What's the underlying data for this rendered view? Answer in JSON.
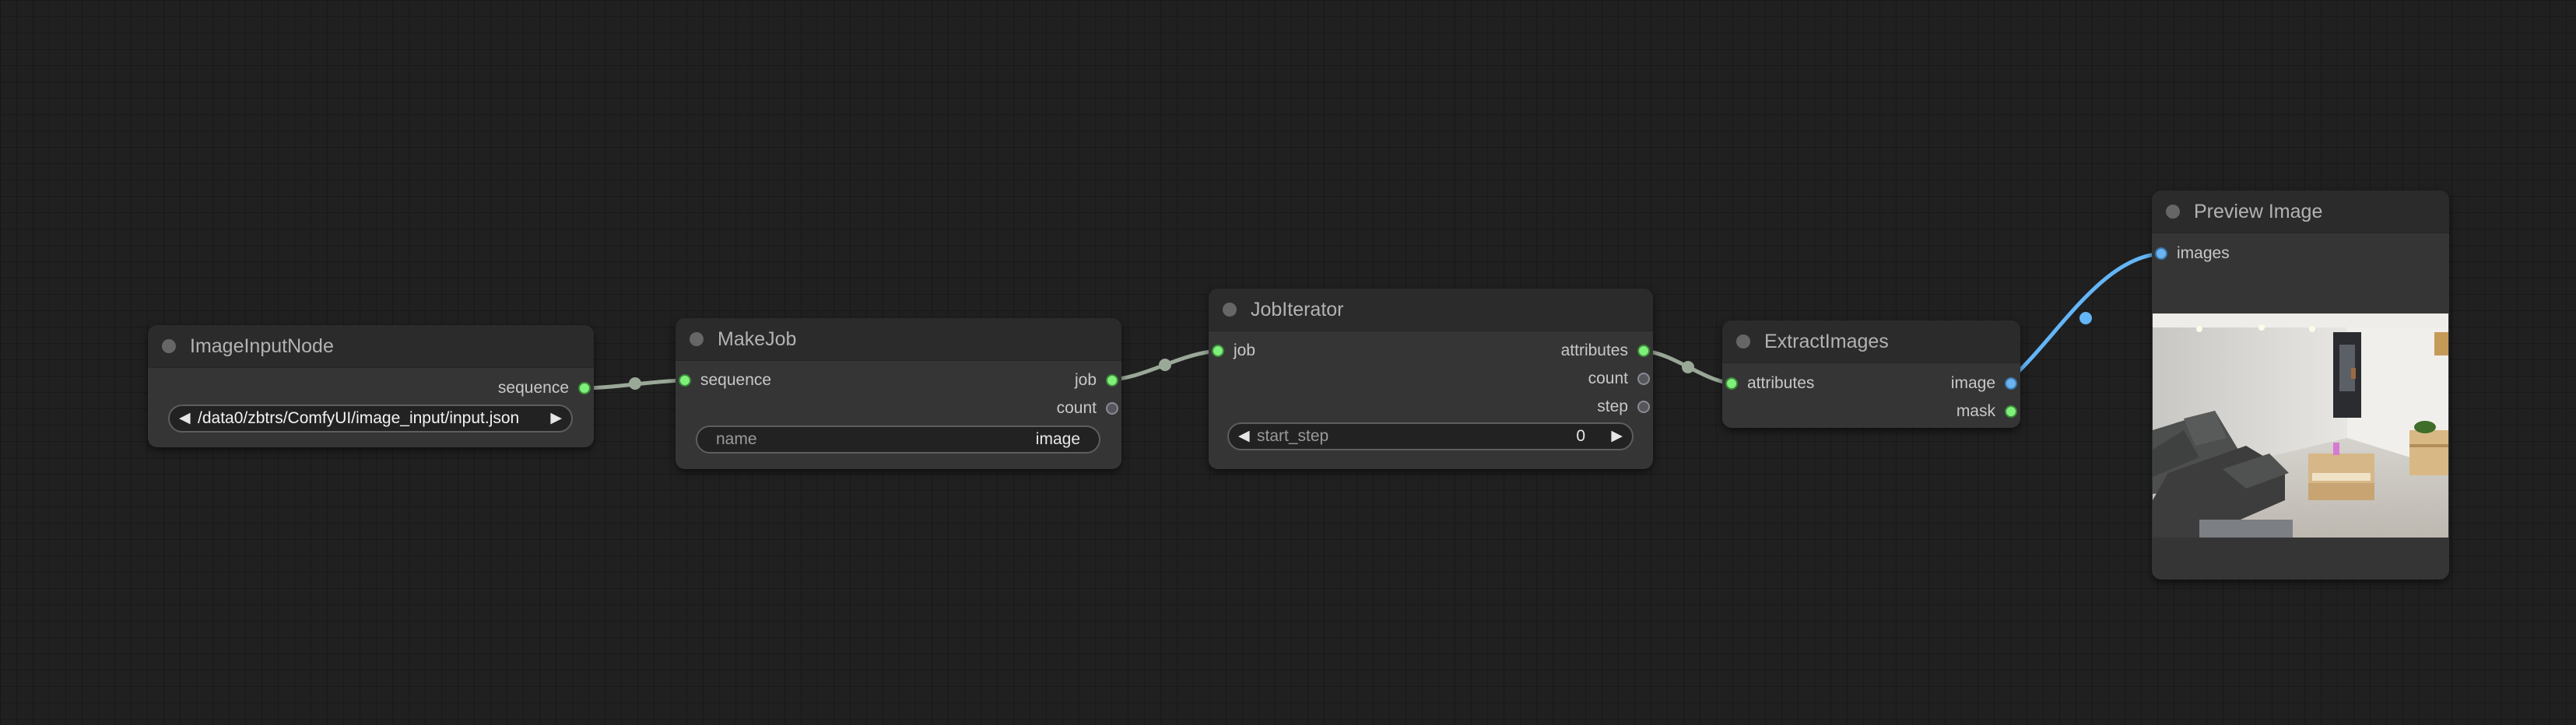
{
  "nodes": {
    "image_input": {
      "title": "ImageInputNode",
      "outputs": [
        "sequence"
      ],
      "widget": {
        "value": "/data0/zbtrs/ComfyUI/image_input/input.json",
        "prev_arrow": "◀",
        "next_arrow": "▶"
      }
    },
    "make_job": {
      "title": "MakeJob",
      "inputs": [
        "sequence"
      ],
      "outputs": [
        "job",
        "count"
      ],
      "widget": {
        "label": "name",
        "value": "image"
      }
    },
    "job_iterator": {
      "title": "JobIterator",
      "inputs": [
        "job"
      ],
      "outputs": [
        "attributes",
        "count",
        "step"
      ],
      "widget": {
        "label": "start_step",
        "value": "0",
        "prev_arrow": "◀",
        "next_arrow": "▶"
      }
    },
    "extract_images": {
      "title": "ExtractImages",
      "inputs": [
        "attributes"
      ],
      "outputs": [
        "image",
        "mask"
      ]
    },
    "preview_image": {
      "title": "Preview Image",
      "inputs": [
        "images"
      ]
    }
  },
  "colors": {
    "link_default": "#9aa898",
    "link_image": "#64b5f6",
    "slot_connected": "#7ff07a",
    "slot_unconnected": "#55555c",
    "slot_image": "#6cb3f0"
  }
}
